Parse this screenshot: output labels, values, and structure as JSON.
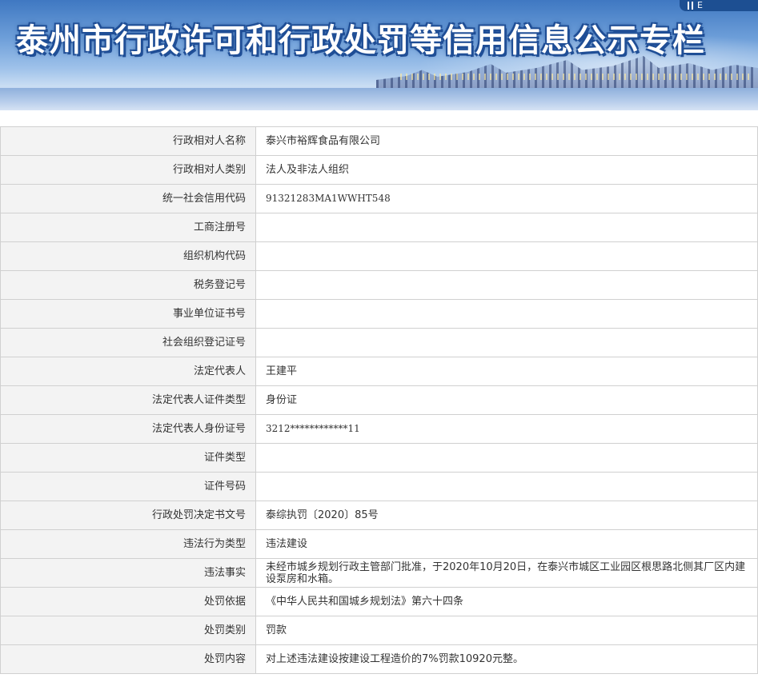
{
  "header": {
    "title": "泰州市行政许可和行政处罚等信用信息公示专栏",
    "corner_label": "E"
  },
  "rows": [
    {
      "label": "行政相对人名称",
      "value": "泰兴市裕辉食品有限公司"
    },
    {
      "label": "行政相对人类别",
      "value": "法人及非法人组织"
    },
    {
      "label": "统一社会信用代码",
      "value": "91321283MA1WWHT548"
    },
    {
      "label": "工商注册号",
      "value": ""
    },
    {
      "label": "组织机构代码",
      "value": ""
    },
    {
      "label": "税务登记号",
      "value": ""
    },
    {
      "label": "事业单位证书号",
      "value": ""
    },
    {
      "label": "社会组织登记证号",
      "value": ""
    },
    {
      "label": "法定代表人",
      "value": "王建平"
    },
    {
      "label": "法定代表人证件类型",
      "value": "身份证"
    },
    {
      "label": "法定代表人身份证号",
      "value": "3212************11"
    },
    {
      "label": "证件类型",
      "value": ""
    },
    {
      "label": "证件号码",
      "value": ""
    },
    {
      "label": "行政处罚决定书文号",
      "value": "泰综执罚〔2020〕85号"
    },
    {
      "label": "违法行为类型",
      "value": "违法建设"
    },
    {
      "label": "违法事实",
      "value": "未经市城乡规划行政主管部门批准，于2020年10月20日，在泰兴市城区工业园区根思路北侧其厂区内建设泵房和水箱。"
    },
    {
      "label": "处罚依据",
      "value": "《中华人民共和国城乡规划法》第六十四条"
    },
    {
      "label": "处罚类别",
      "value": "罚款"
    },
    {
      "label": "处罚内容",
      "value": "对上述违法建设按建设工程造价的7%罚款10920元整。"
    }
  ]
}
